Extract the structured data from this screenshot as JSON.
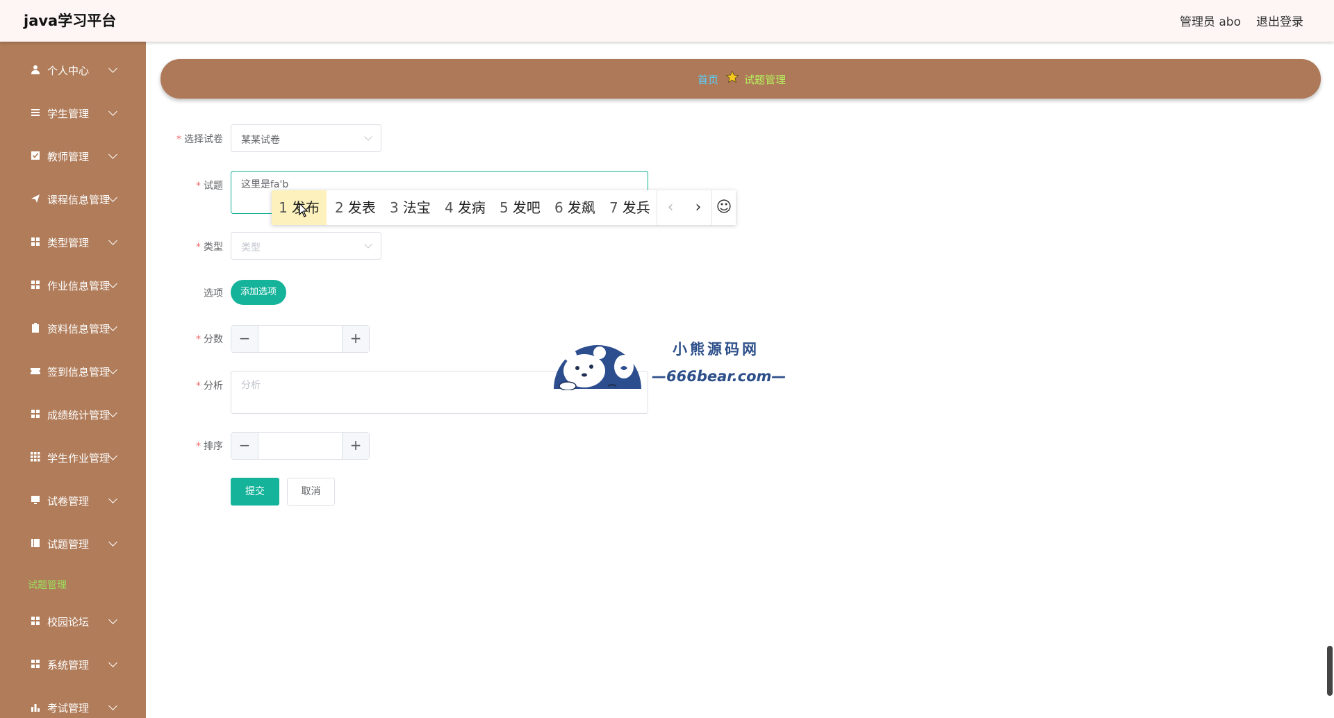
{
  "header": {
    "brand": "java学习平台",
    "admin": "管理员 abo",
    "logout": "退出登录"
  },
  "sidebar": {
    "items": [
      {
        "label": "个人中心",
        "icon": "user-icon"
      },
      {
        "label": "学生管理",
        "icon": "list-icon"
      },
      {
        "label": "教师管理",
        "icon": "checkbox-icon"
      },
      {
        "label": "课程信息管理",
        "icon": "send-icon"
      },
      {
        "label": "类型管理",
        "icon": "grid-icon"
      },
      {
        "label": "作业信息管理",
        "icon": "grid-icon"
      },
      {
        "label": "资料信息管理",
        "icon": "clipboard-icon"
      },
      {
        "label": "签到信息管理",
        "icon": "ticket-icon"
      },
      {
        "label": "成绩统计管理",
        "icon": "grid-icon"
      },
      {
        "label": "学生作业管理",
        "icon": "apps-icon"
      },
      {
        "label": "试卷管理",
        "icon": "monitor-icon"
      },
      {
        "label": "试题管理",
        "icon": "notebook-icon"
      },
      {
        "label": "校园论坛",
        "icon": "grid-icon"
      },
      {
        "label": "系统管理",
        "icon": "grid-icon"
      },
      {
        "label": "考试管理",
        "icon": "bar-chart-icon"
      }
    ],
    "active_sub": "试题管理"
  },
  "breadcrumb": {
    "home": "首页",
    "current": "试题管理",
    "separator_icon": "star-icon"
  },
  "form": {
    "paper": {
      "label": "选择试卷",
      "value": "某某试卷"
    },
    "question": {
      "label": "试题",
      "value": "这里是fa'b"
    },
    "type": {
      "label": "类型",
      "placeholder": "类型"
    },
    "options": {
      "label": "选项",
      "add_button": "添加选项"
    },
    "score": {
      "label": "分数",
      "value": ""
    },
    "analysis": {
      "label": "分析",
      "placeholder": "分析"
    },
    "sort": {
      "label": "排序",
      "value": ""
    },
    "submit": "提交",
    "cancel": "取消"
  },
  "ime": {
    "candidates": [
      {
        "num": "1",
        "text": "发布"
      },
      {
        "num": "2",
        "text": "发表"
      },
      {
        "num": "3",
        "text": "法宝"
      },
      {
        "num": "4",
        "text": "发病"
      },
      {
        "num": "5",
        "text": "发吧"
      },
      {
        "num": "6",
        "text": "发飙"
      },
      {
        "num": "7",
        "text": "发兵"
      }
    ],
    "prev": "‹",
    "next": "›",
    "emoji": "☺"
  },
  "watermark": {
    "line1": "小熊源码网",
    "line2": "—666bear.com—"
  },
  "colors": {
    "sidebar": "#b07c5a",
    "accent": "#14b39a",
    "breadcrumb_bar": "#ae7959"
  }
}
